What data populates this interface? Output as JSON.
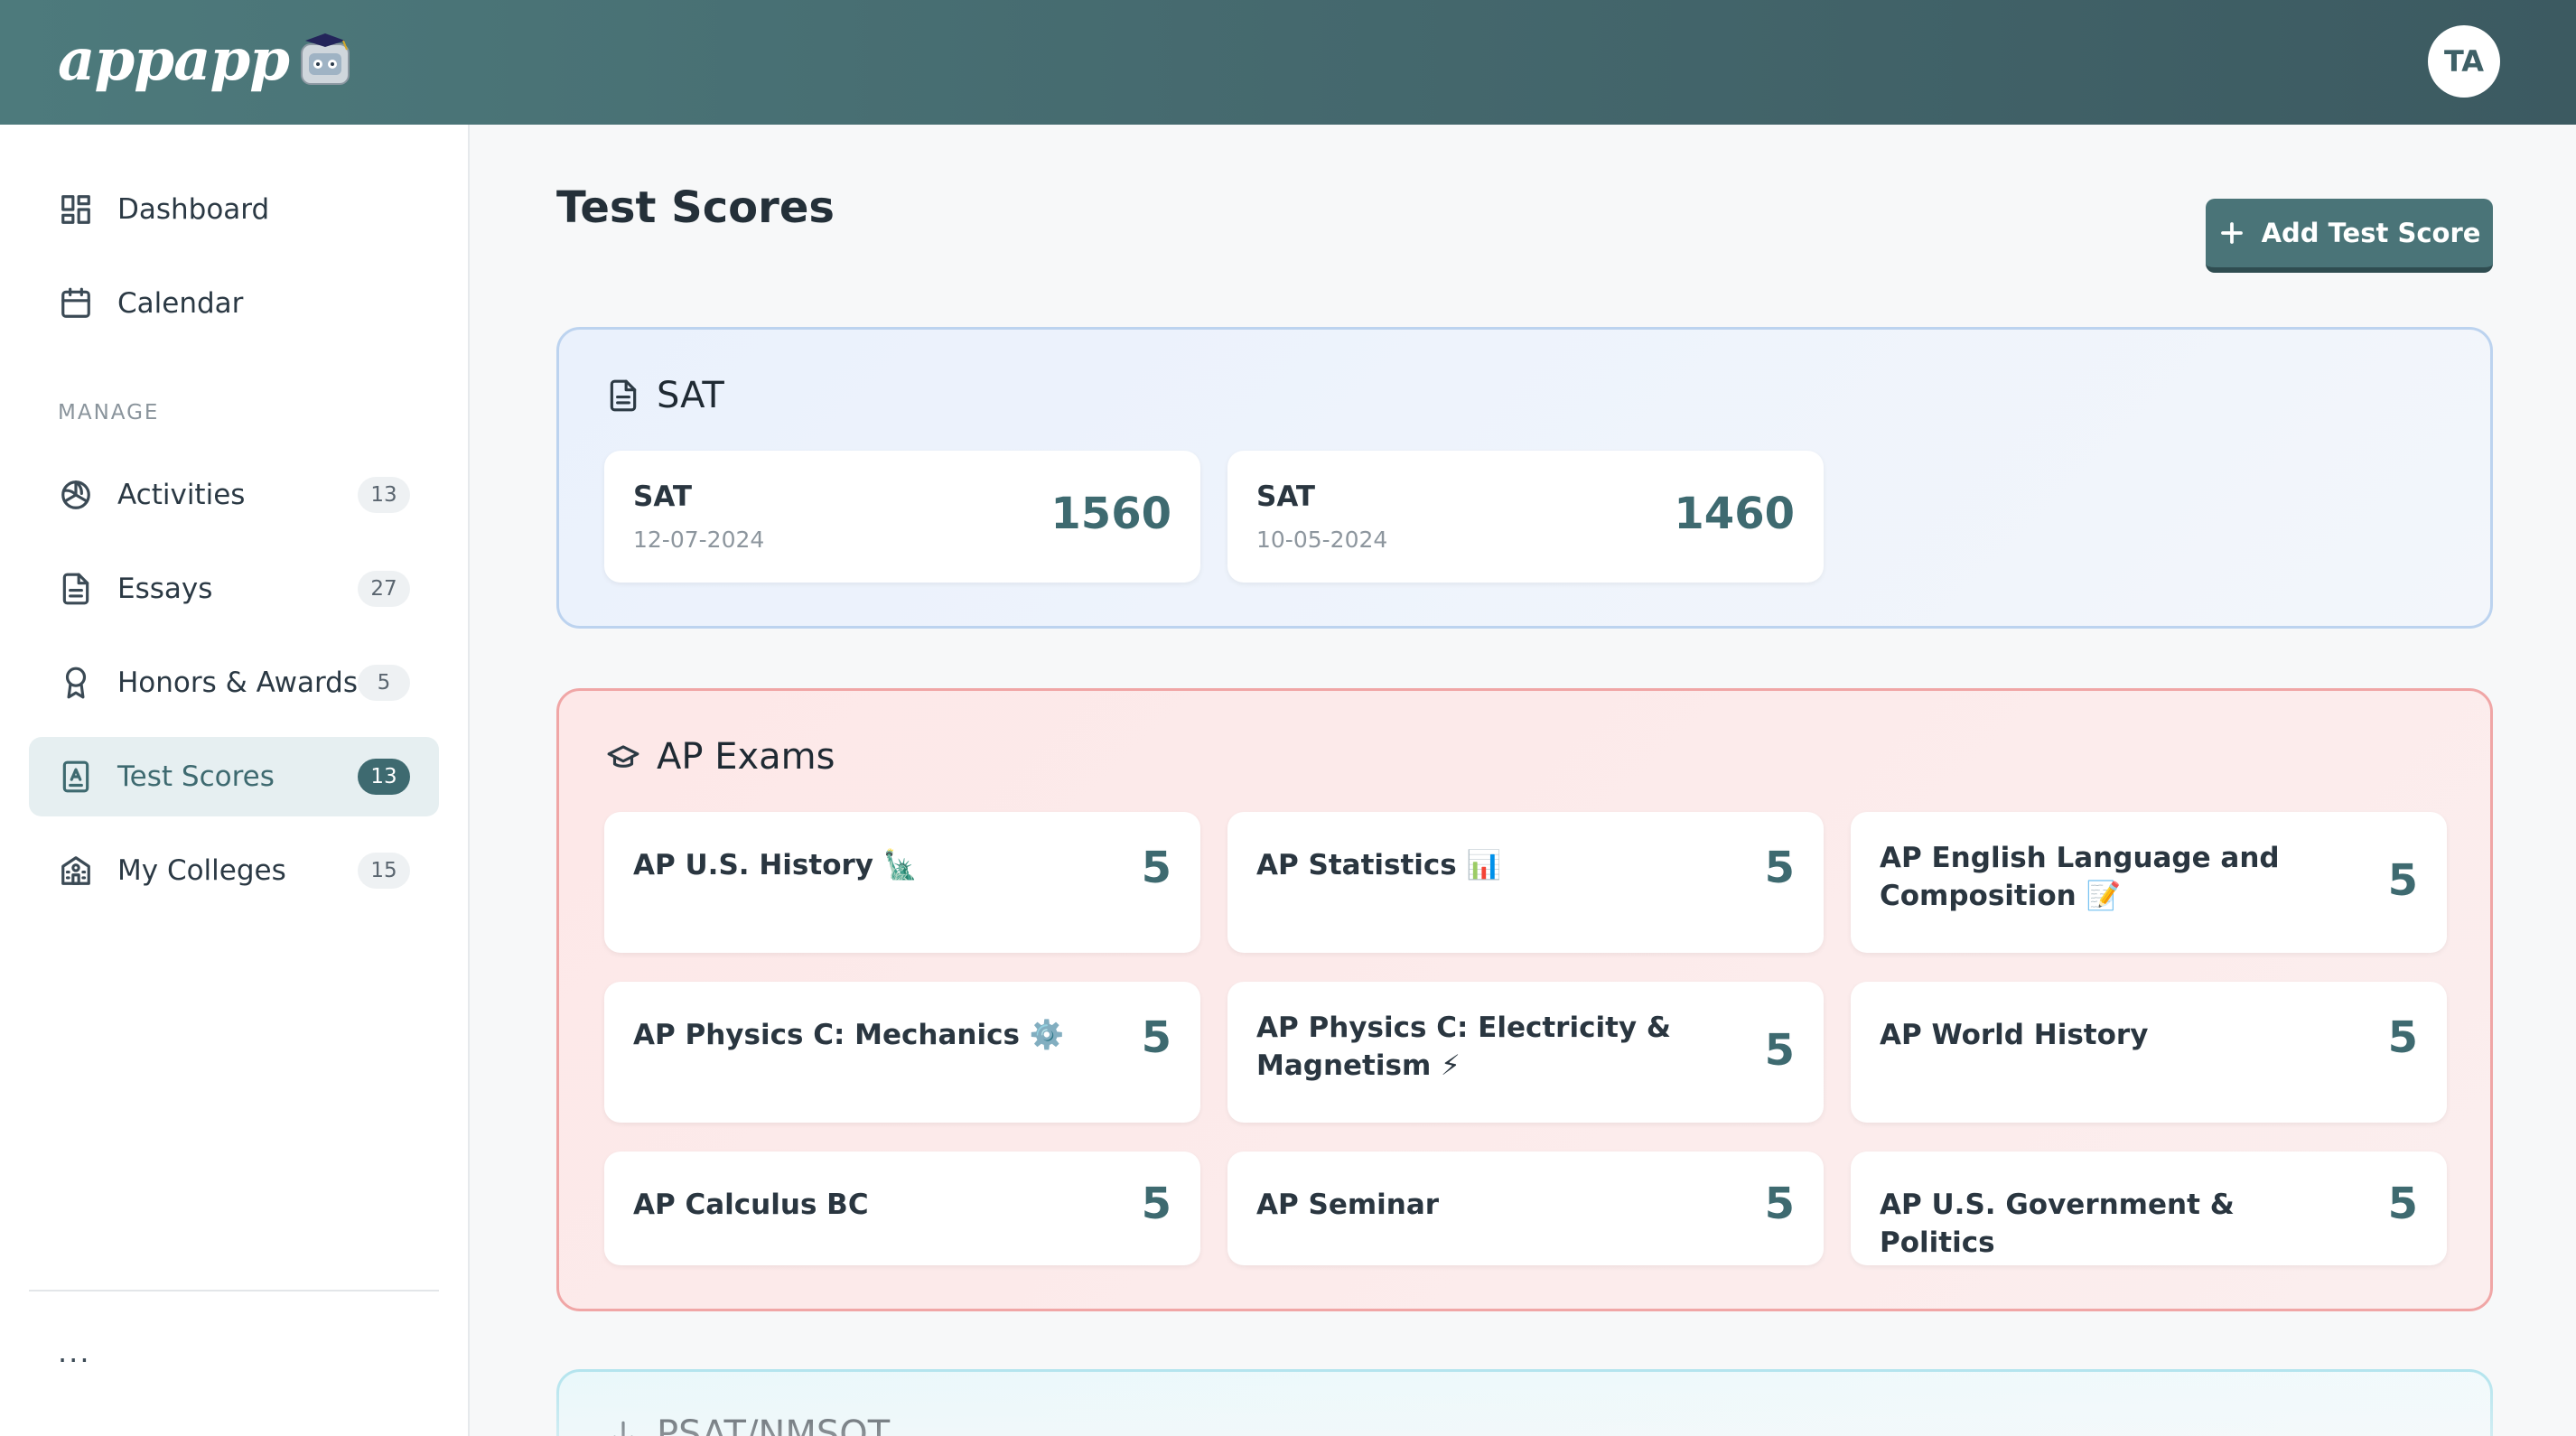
{
  "header": {
    "logo_text": "appapp",
    "avatar_initials": "TA"
  },
  "sidebar": {
    "items": [
      {
        "label": "Dashboard",
        "icon": "dashboard-icon"
      },
      {
        "label": "Calendar",
        "icon": "calendar-icon"
      }
    ],
    "section_label": "MANAGE",
    "manage_items": [
      {
        "label": "Activities",
        "badge": "13",
        "icon": "volleyball-icon"
      },
      {
        "label": "Essays",
        "badge": "27",
        "icon": "document-icon"
      },
      {
        "label": "Honors & Awards",
        "badge": "5",
        "icon": "award-icon"
      },
      {
        "label": "Test Scores",
        "badge": "13",
        "icon": "test-icon",
        "active": true
      },
      {
        "label": "My Colleges",
        "badge": "15",
        "icon": "college-icon"
      }
    ],
    "more_label": "..."
  },
  "main": {
    "title": "Test Scores",
    "add_button_label": "Add Test Score",
    "sat": {
      "title": "SAT",
      "scores": [
        {
          "name": "SAT",
          "date": "12-07-2024",
          "score": "1560"
        },
        {
          "name": "SAT",
          "date": "10-05-2024",
          "score": "1460"
        }
      ]
    },
    "ap": {
      "title": "AP Exams",
      "exams": [
        {
          "name": "AP U.S. History 🗽",
          "score": "5"
        },
        {
          "name": "AP Statistics 📊",
          "score": "5"
        },
        {
          "name": "AP English Language and Composition 📝",
          "score": "5"
        },
        {
          "name": "AP Physics C: Mechanics ⚙️",
          "score": "5"
        },
        {
          "name": "AP Physics C: Electricity & Magnetism ⚡",
          "score": "5"
        },
        {
          "name": "AP World History",
          "score": "5"
        },
        {
          "name": "AP Calculus BC",
          "score": "5"
        },
        {
          "name": "AP Seminar",
          "score": "5"
        },
        {
          "name": "AP U.S. Government & Politics",
          "score": "5"
        }
      ]
    },
    "psat": {
      "title": "PSAT/NMSQT"
    }
  },
  "colors": {
    "header": "#45696e",
    "accent": "#3e6a70",
    "sat_border": "#bcd3ef",
    "ap_border": "#f0a6a6",
    "psat_border": "#a9e1ec"
  }
}
